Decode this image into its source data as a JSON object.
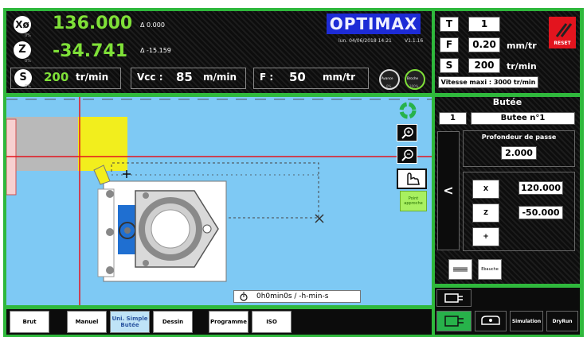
{
  "axes": {
    "x": {
      "label": "Xø",
      "value": "136.000",
      "delta": "Δ 0.000",
      "small": "0%"
    },
    "z": {
      "label": "Z",
      "value": "-34.741",
      "delta": "Δ -15.159",
      "small": "0%"
    }
  },
  "status": {
    "s_label": "S",
    "s_value": "200",
    "s_unit": "tr/min",
    "s_small": "0%",
    "vcc_label": "Vcc :",
    "vcc_value": "85",
    "vcc_unit": "m/min",
    "f_label": "F :",
    "f_value": "50",
    "f_unit": "mm/tr",
    "avance": "Avance",
    "avance_pct": "0%",
    "broche": "Broche",
    "broche_pct": "100%"
  },
  "brand": {
    "logo": "OPTIMAX",
    "datetime": "lun. 04/06/2018 14:21",
    "version": "V1.1.16"
  },
  "tool": {
    "t_label": "T",
    "t_value": "1",
    "f_label": "F",
    "f_value": "0.20",
    "f_unit": "mm/tr",
    "s_label": "S",
    "s_value": "200",
    "s_unit": "tr/min",
    "vmax": "Vitesse maxi : 3000 tr/min",
    "reset": "RESET"
  },
  "butee": {
    "title": "Butée",
    "number": "1",
    "name": "Butee n°1",
    "depth_label": "Profondeur de passe",
    "depth_value": "2.000",
    "back": "<",
    "x_label": "X",
    "x_value": "120.000",
    "z_label": "Z",
    "z_value": "-50.000",
    "plus": "+",
    "ebauche": "Ebauche"
  },
  "view": {
    "timer": "0h0min0s / -h-min-s",
    "point_approche": "Point approche"
  },
  "tabs": [
    "Brut",
    "Manuel",
    "Uni. Simple Butée",
    "Dessin",
    "Programme",
    "ISO"
  ],
  "bottom_right": {
    "simulation": "Simulation",
    "dryrun": "DryRun"
  },
  "colors": {
    "frame": "#2fb83c",
    "canvas": "#7ec9f4",
    "accent_green": "#27b24a",
    "active_tab": "#bfe3f7",
    "yellow": "#f2ee1d",
    "red": "#e3141e"
  }
}
